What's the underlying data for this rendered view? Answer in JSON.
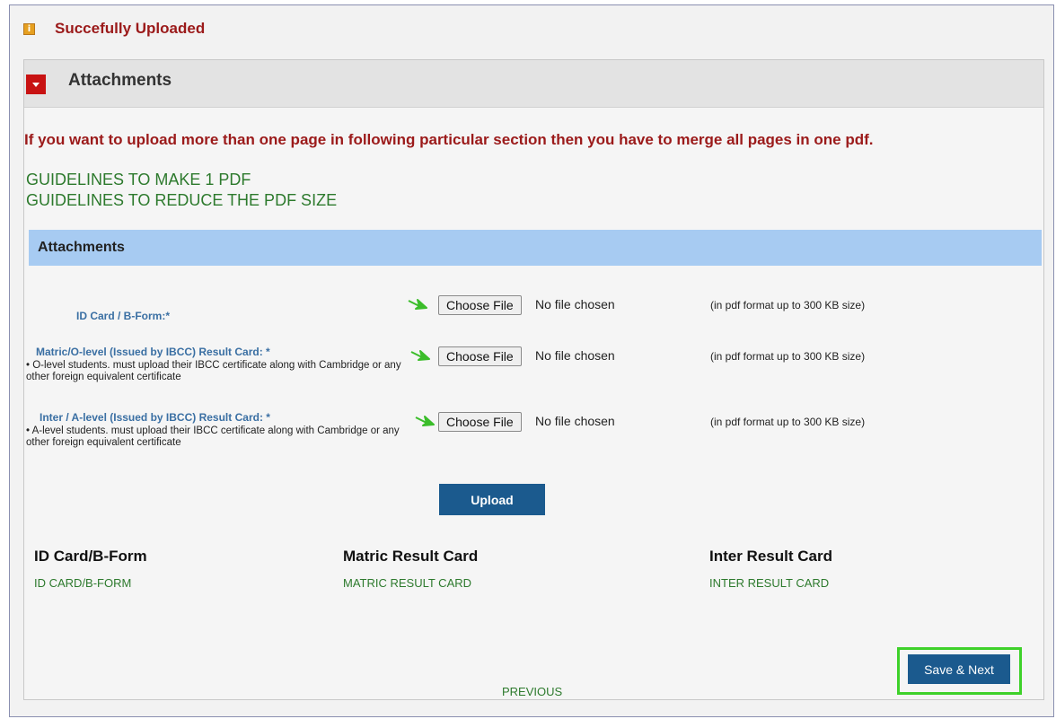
{
  "alert": {
    "icon": "info-icon",
    "icon_glyph": "i",
    "message": "Succefully Uploaded"
  },
  "panel": {
    "title": "Attachments",
    "toggle_icon": "caret-down-icon",
    "warning": "If you want to upload more than one page in following particular section then you have to merge all pages in one pdf.",
    "guidelines": [
      "GUIDELINES TO MAKE 1 PDF",
      "GUIDELINES TO REDUCE THE PDF SIZE"
    ]
  },
  "attachments_section": {
    "title": "Attachments",
    "fields": [
      {
        "label": "ID Card / B-Form:*",
        "note": "",
        "button": "Choose File",
        "status": "No file chosen",
        "hint": "(in pdf format up to 300 KB size)"
      },
      {
        "label": "Matric/O-level (Issued by IBCC) Result Card: *",
        "note": "• O-level students. must upload their IBCC certificate along with Cambridge  or any other foreign equivalent certificate",
        "button": "Choose File",
        "status": "No file chosen",
        "hint": "(in pdf format up to 300 KB size)"
      },
      {
        "label": "Inter / A-level (Issued by IBCC) Result Card: *",
        "note": "• A-level students. must upload their IBCC certificate along with Cambridge  or any other foreign equivalent certificate",
        "button": "Choose File",
        "status": "No file chosen",
        "hint": "(in pdf format up to 300 KB size)"
      }
    ],
    "upload_label": "Upload"
  },
  "results": [
    {
      "heading": "ID Card/B-Form",
      "link": "ID CARD/B-FORM"
    },
    {
      "heading": "Matric Result Card",
      "link": "MATRIC RESULT CARD"
    },
    {
      "heading": "Inter Result Card",
      "link": "INTER RESULT CARD"
    }
  ],
  "footer": {
    "save_label": "Save & Next",
    "previous_label": "PREVIOUS"
  },
  "colors": {
    "accent_blue": "#1b5a8e",
    "error_red": "#9b1a1a",
    "link_green": "#2d7a2d",
    "section_blue": "#a7cbf2",
    "highlight_green": "#3ed12a"
  }
}
